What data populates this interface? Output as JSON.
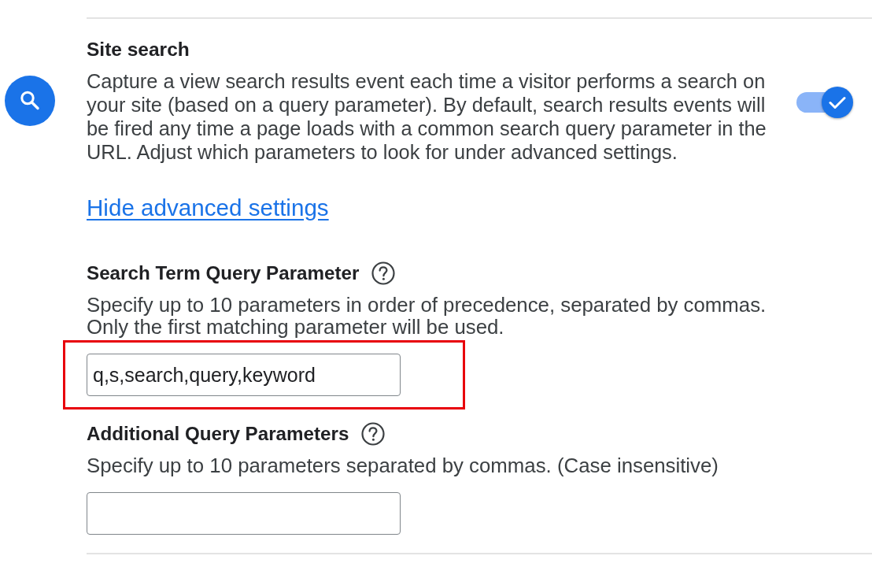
{
  "feature": {
    "title": "Site search",
    "description": "Capture a view search results event each time a visitor performs a search on your site (based on a query parameter). By default, search results events will be fired any time a page loads with a common search query parameter in the URL. Adjust which parameters to look for under advanced settings.",
    "enabled": true
  },
  "advanced_link": "Hide advanced settings",
  "fields": [
    {
      "label": "Search Term Query Parameter",
      "help": "Specify up to 10 parameters in order of precedence, separated by commas. Only the first matching parameter will be used.",
      "value": "q,s,search,query,keyword",
      "highlighted": true
    },
    {
      "label": "Additional Query Parameters",
      "help": "Specify up to 10 parameters separated by commas. (Case insensitive)",
      "highlighted": false
    }
  ]
}
